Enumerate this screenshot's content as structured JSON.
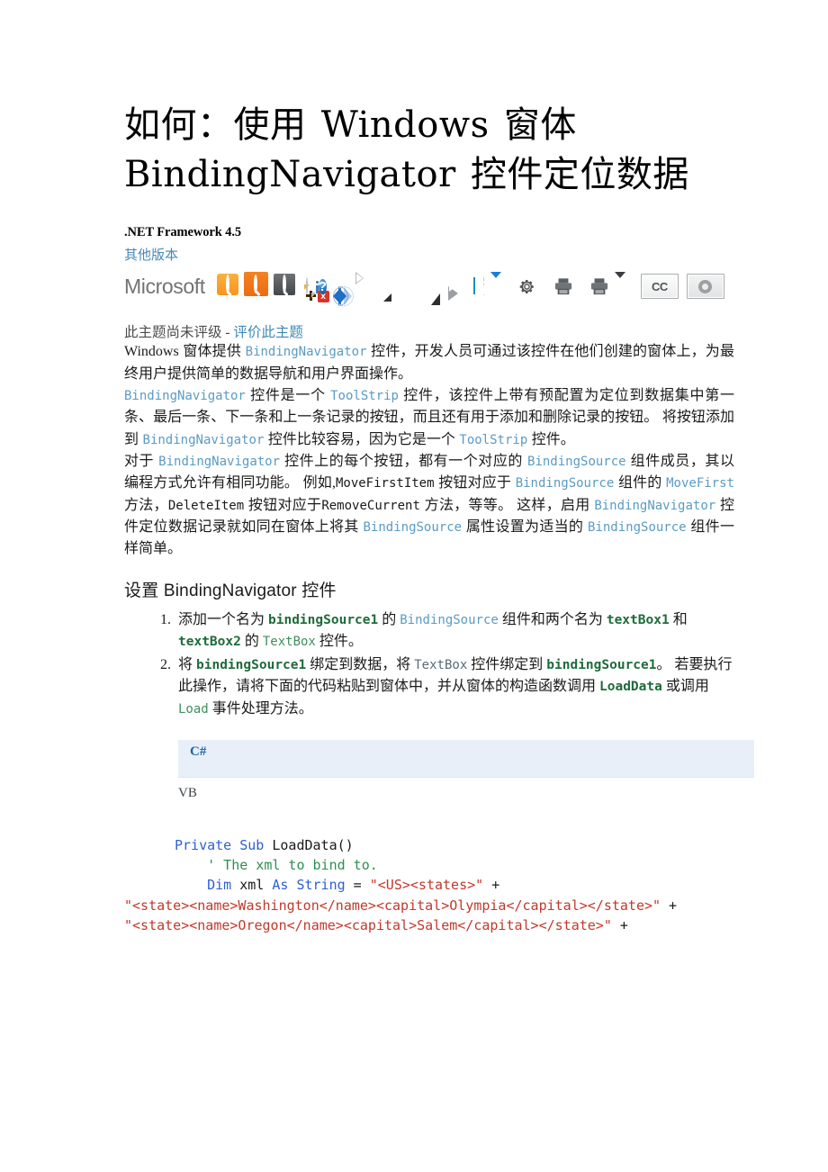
{
  "document": {
    "title": "如何：使用 Windows 窗体 BindingNavigator 控件定位数据",
    "framework": ".NET Framework 4.5",
    "other_versions_link": "其他版本"
  },
  "toolbar": {
    "brand": "Microsoft",
    "icons": [
      "magnifier-light-orange-icon",
      "magnifier-dark-orange-icon",
      "magnifier-grey-icon",
      "add-balloon-icon",
      "info-balloon-icon",
      "close-blue-icon",
      "help-question-icon",
      "prev-shutter-icon",
      "next-shutter-icon",
      "play-outline-icon",
      "half-triangle-icon",
      "dot-icon",
      "rss-icon",
      "solid-triangle-icon",
      "play-outline-large-icon",
      "info-cyan-icon",
      "caret-blue-icon",
      "gear-icon",
      "print-icon",
      "print-options-icon",
      "cc-button",
      "circle-button"
    ],
    "cc_label": "CC"
  },
  "rating": {
    "text": "此主题尚未评级 - ",
    "link": "评价此主题"
  },
  "intro": {
    "p1_a": "Windows 窗体提供 ",
    "p1_code1": "BindingNavigator",
    "p1_b": " 控件，开发人员可通过该控件在他们创建的窗体上，为最终用户提供简单的数据导航和用户界面操作。",
    "p2_code1": "BindingNavigator",
    "p2_a": " 控件是一个 ",
    "p2_code2": "ToolStrip",
    "p2_b": " 控件，该控件上带有预配置为定位到数据集中第一条、最后一条、下一条和上一条记录的按钮，而且还有用于添加和删除记录的按钮。 将按钮添加到 ",
    "p2_code3": "BindingNavigator",
    "p2_c": " 控件比较容易，因为它是一个 ",
    "p2_code4": "ToolStrip",
    "p2_d": " 控件。",
    "p3_a": "对于 ",
    "p3_code1": "BindingNavigator",
    "p3_b": " 控件上的每个按钮，都有一个对应的 ",
    "p3_code2": "BindingSource",
    "p3_c": " 组件成员，其以编程方式允许有相同功能。 例如,",
    "p3_code3": "MoveFirstItem",
    "p3_d": " 按钮对应于 ",
    "p3_code4": "BindingSource",
    "p3_e": " 组件的 ",
    "p3_code5": "MoveFirst",
    "p3_f": " 方法，",
    "p3_code6": "DeleteItem",
    "p3_g": " 按钮对应于",
    "p3_code7": "RemoveCurrent",
    "p3_h": " 方法，等等。 这样，启用 ",
    "p3_code8": "BindingNavigator",
    "p3_i": " 控件定位数据记录就如同在窗体上将其 ",
    "p3_code9": "BindingSource",
    "p3_j": " 属性设置为适当的 ",
    "p3_code10": "BindingSource",
    "p3_k": " 组件一样简单。"
  },
  "section": {
    "heading": "设置 BindingNavigator 控件",
    "steps": [
      {
        "a": "添加一个名为 ",
        "code1": "bindingSource1",
        "b": " 的 ",
        "code2": "BindingSource",
        "c": " 组件和两个名为 ",
        "code3": "textBox1",
        "d": " 和 ",
        "code4": "textBox2",
        "e": " 的 ",
        "code5": "TextBox",
        "f": " 控件。"
      },
      {
        "a": "将 ",
        "code1": "bindingSource1",
        "b": " 绑定到数据，将 ",
        "code2": "TextBox",
        "c": " 控件绑定到 ",
        "code3": "bindingSource1",
        "d": "。 若要执行此操作，请将下面的代码粘贴到窗体中，并从窗体的构造函数调用 ",
        "code4": "LoadData",
        "e": " 或调用 ",
        "code5": "Load",
        "f": " 事件处理方法。"
      }
    ]
  },
  "code_block": {
    "tab_csharp": "C#",
    "label_vb": "VB",
    "lines": [
      {
        "segments": [
          {
            "t": "Private Sub ",
            "c": "kw"
          },
          {
            "t": "LoadData()",
            "c": ""
          }
        ]
      },
      {
        "segments": [
          {
            "t": "    ' The xml to bind to.",
            "c": "cmt"
          }
        ]
      },
      {
        "segments": [
          {
            "t": "    ",
            "c": ""
          },
          {
            "t": "Dim ",
            "c": "kw"
          },
          {
            "t": "xml ",
            "c": ""
          },
          {
            "t": "As String",
            "c": "kw"
          },
          {
            "t": " = ",
            "c": ""
          },
          {
            "t": "\"<US><states>\"",
            "c": "str"
          },
          {
            "t": " +",
            "c": ""
          }
        ]
      },
      {
        "segments": [
          {
            "t": "\"<state><name>Washington</name><capital>Olympia</capital></state>\"",
            "c": "str"
          },
          {
            "t": " +",
            "c": ""
          }
        ]
      },
      {
        "segments": [
          {
            "t": "\"<state><name>Oregon</name><capital>Salem</capital></state>\"",
            "c": "str"
          },
          {
            "t": " +",
            "c": ""
          }
        ]
      }
    ]
  }
}
